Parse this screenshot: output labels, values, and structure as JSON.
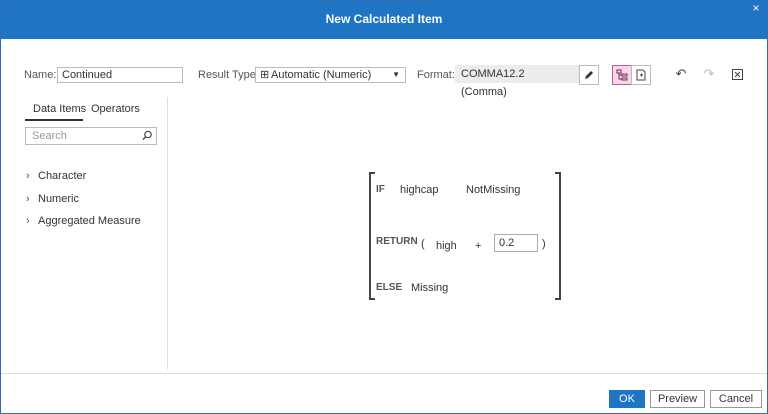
{
  "dialog": {
    "title": "New Calculated Item",
    "close_glyph": "×"
  },
  "toolbar": {
    "name_label": "Name:",
    "name_value": "Continued",
    "result_type_label": "Result Type:",
    "result_type_value": "Automatic (Numeric)",
    "format_label": "Format:",
    "format_value": "COMMA12.2 (Comma)"
  },
  "left_panel": {
    "tabs": [
      "Data Items",
      "Operators"
    ],
    "search_placeholder": "Search",
    "tree": [
      "Character",
      "Numeric",
      "Aggregated Measure"
    ]
  },
  "expression": {
    "if_kw": "IF",
    "if_item": "highcap",
    "if_cond": "NotMissing",
    "return_kw": "RETURN",
    "open_paren": "(",
    "return_item": "high",
    "operator": "+",
    "operand": "0.2",
    "close_paren": ")",
    "else_kw": "ELSE",
    "else_value": "Missing"
  },
  "footer": {
    "ok": "OK",
    "preview": "Preview",
    "cancel": "Cancel"
  },
  "colors": {
    "titlebar": "#1f74c4",
    "active_toggle": "#f7d8ea"
  }
}
